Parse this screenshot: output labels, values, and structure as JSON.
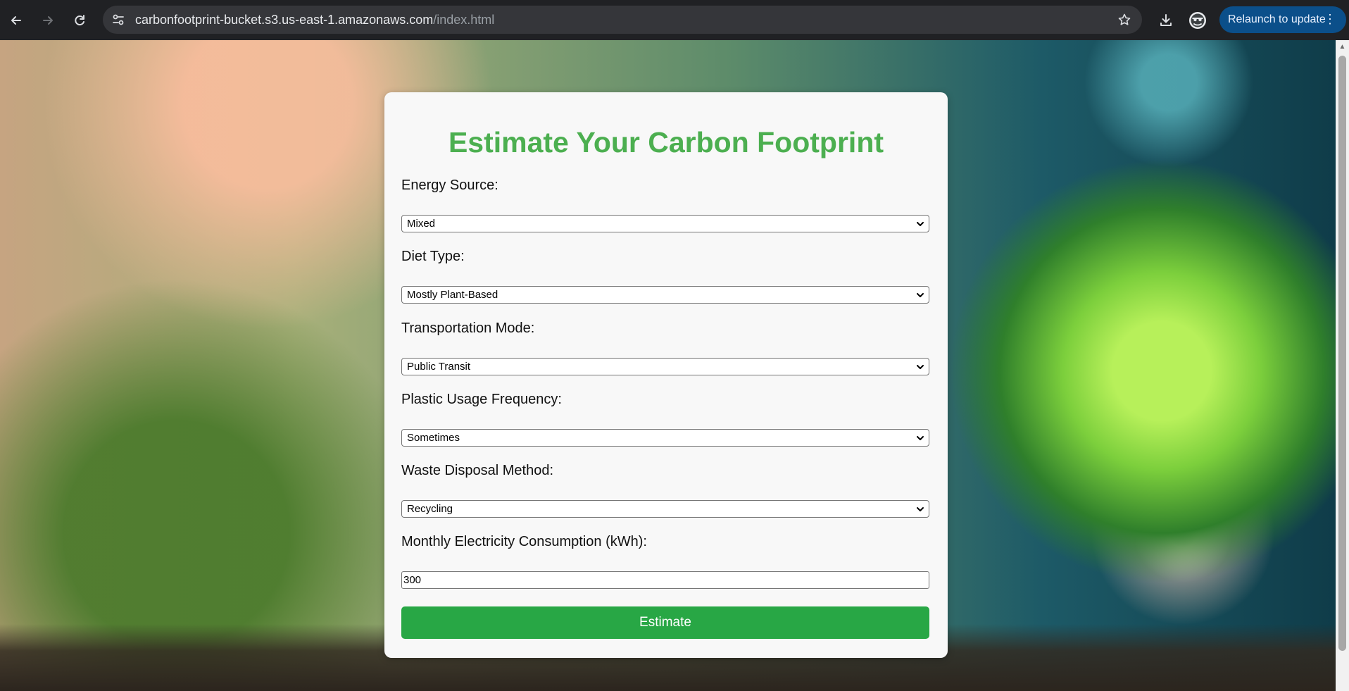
{
  "browser": {
    "url_host": "carbonfootprint-bucket.s3.us-east-1.amazonaws.com",
    "url_path": "/index.html",
    "relaunch_label": "Relaunch to update",
    "menu_glyph": "⋮"
  },
  "form": {
    "title": "Estimate Your Carbon Footprint",
    "fields": [
      {
        "label": "Energy Source:",
        "value": "Mixed"
      },
      {
        "label": "Diet Type:",
        "value": "Mostly Plant-Based"
      },
      {
        "label": "Transportation Mode:",
        "value": "Public Transit"
      },
      {
        "label": "Plastic Usage Frequency:",
        "value": "Sometimes"
      },
      {
        "label": "Waste Disposal Method:",
        "value": "Recycling"
      },
      {
        "label": "Monthly Electricity Consumption (kWh):",
        "value": "300"
      }
    ],
    "button_label": "Estimate"
  },
  "colors": {
    "title": "#4caf50",
    "button": "#28a745",
    "relaunch": "#0b4f8a"
  },
  "icons": {
    "back": "back-arrow-icon",
    "forward": "forward-arrow-icon",
    "reload": "reload-icon",
    "site_info": "tune-icon",
    "bookmark": "star-icon",
    "download": "download-icon",
    "profile": "avatar-icon",
    "dropdown": "chevron-down-icon"
  }
}
